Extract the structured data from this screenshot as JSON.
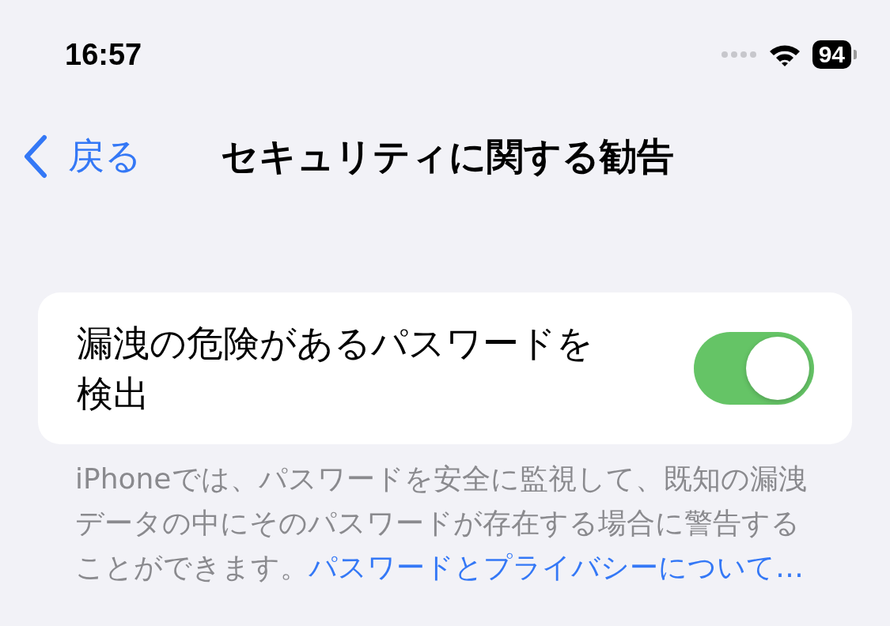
{
  "status_bar": {
    "time": "16:57",
    "battery": "94"
  },
  "nav": {
    "back": "戻る",
    "title": "セキュリティに関する勧告"
  },
  "setting": {
    "label": "漏洩の危険があるパスワードを検出",
    "on": true
  },
  "footer": {
    "text": "iPhoneでは、パスワードを安全に監視して、既知の漏洩データの中にそのパスワードが存在する場合に警告することができます。",
    "link": "パスワードとプライバシーについて…"
  }
}
